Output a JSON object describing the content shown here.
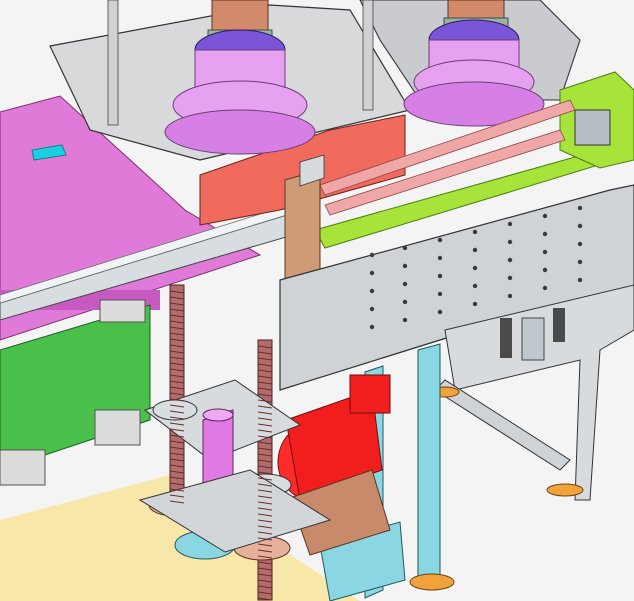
{
  "scene": {
    "kind": "cad-3d-viewport",
    "background": "#f4f4f4",
    "floor_color": "#f7e7a8",
    "colors": {
      "magenta_plate": "#e07ad9",
      "green_panel": "#49c04a",
      "red_motor": "#f21d1d",
      "gray_frame": "#cfd3d6",
      "cyan_column": "#8ad7e3",
      "lime_rail": "#a8e33a",
      "salmon_block": "#f06a5e",
      "copper": "#d28a6a",
      "violet_cylinder": "#e6a2f1",
      "purple_ring": "#7a55d8"
    },
    "parts": [
      "magenta-base-plate",
      "green-side-panel",
      "linear-guide-rail",
      "lead-screws",
      "red-motor",
      "gray-machine-frame",
      "cyan-support-columns",
      "lime-rail",
      "pink-cylinders",
      "stack-cylinders-left",
      "stack-cylinders-right",
      "bearing-flanges"
    ]
  }
}
